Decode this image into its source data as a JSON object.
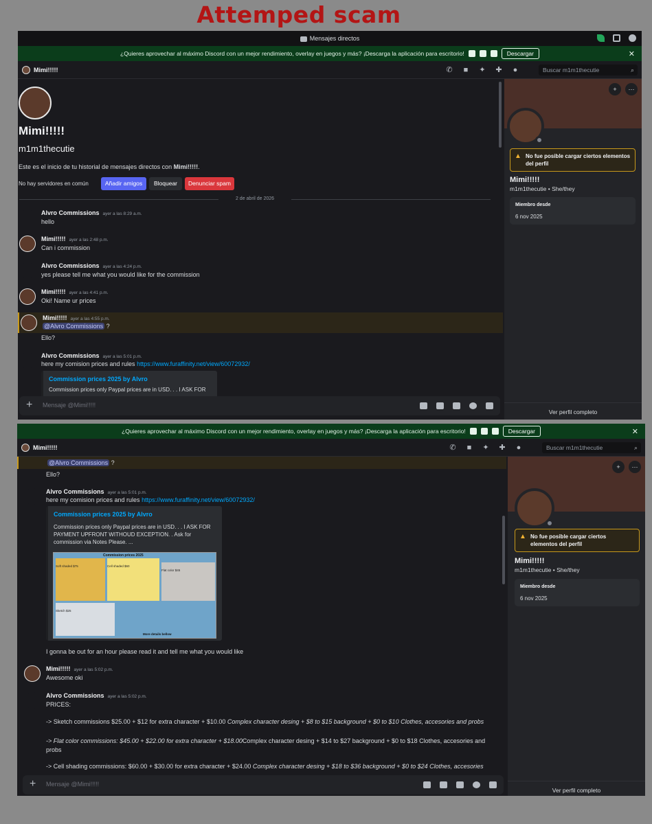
{
  "page_title": "Attemped scam",
  "titlebar": {
    "label": "Mensajes directos"
  },
  "banner": {
    "text": "¿Quieres aprovechar al máximo Discord con un mejor rendimiento, overlay en juegos y más? ¡Descarga la aplicación para escritorio!",
    "download_label": "Descargar",
    "close": "✕"
  },
  "header": {
    "channel_name": "Mimi!!!!!",
    "search_placeholder": "Buscar m1m1thecutie"
  },
  "intro": {
    "display_name": "Mimi!!!!!",
    "username": "m1m1thecutie",
    "start_text_prefix": "Este es el inicio de tu historial de mensajes directos con ",
    "start_text_name": "Mimi!!!!!",
    "start_text_suffix": ".",
    "no_servers": "No hay servidores en común",
    "add_friend": "Añadir amigos",
    "block": "Bloquear",
    "report_spam": "Denunciar spam",
    "date_divider": "2 de abril de 2026"
  },
  "messages": [
    {
      "author": "Alvro Commissions",
      "time": "ayer a las 8:29 a.m.",
      "text": "hello"
    },
    {
      "author": "Mimi!!!!!",
      "time": "ayer a las 2:48 p.m.",
      "text": "Can i commission"
    },
    {
      "author": "Alvro Commissions",
      "time": "ayer a las 4:24 p.m.",
      "text": "yes please tell me what you would like for the commission"
    },
    {
      "author": "Mimi!!!!!",
      "time": "ayer a las 4:41 p.m.",
      "text": "Oki! Name ur prices"
    },
    {
      "author": "Mimi!!!!!",
      "time": "ayer a las 4:55 p.m.",
      "mention": "@Alvro Commissions",
      "mention_suffix": " ?",
      "text": "Ello?"
    },
    {
      "author": "Alvro Commissions",
      "time": "ayer a las 5:01 p.m.",
      "text": "here my comision prices and rules",
      "link": "https://www.furaffinity.net/view/60072932/"
    },
    {
      "after_embed": "I gonna be out for an hour please read it and tell me what you would like"
    },
    {
      "author": "Mimi!!!!!",
      "time": "ayer a las 5:02 p.m.",
      "text": "Awesome oki"
    },
    {
      "author": "Alvro Commissions",
      "time": "ayer a las 5:02 p.m.",
      "text": "PRICES:"
    }
  ],
  "embed": {
    "title": "Commission prices 2025 by Alvro",
    "desc_short": "Commission prices only Paypal prices are in USD. . . I ASK FOR",
    "desc_full": "Commission prices only Paypal prices are in USD. . . I ASK FOR PAYMENT UPFRONT WITHOUD EXCEPTION. . Ask for commission via Notes Please. ...",
    "image_title": "Commission prices 2025",
    "image_labels": [
      "Soft shaded $75",
      "Cell shaded $60",
      "Flat color $45",
      "Sketch $25"
    ],
    "image_note": "More details bellow"
  },
  "prices": {
    "sketch_plain": "-> Sketch commissions $25.00 + $12 for extra character + $10.00 ",
    "sketch_italic": "Complex character desing + $8 to $15 background + $0 to $10 Clothes, accesories and probs",
    "flat_italic": "-> Flat color commissions: $45.00 + $22.00 for extra character + $18.00",
    "flat_plain": "Complex character desing + $14 to $27 background + $0 to $18 Clothes, accesories and probs",
    "cell_plain": "-> Cell shading commissions: $60.00 + $30.00 for extra character + $24.00 ",
    "cell_italic": "Complex character desing + $18 to $36 background + $0 to $24 Clothes, accesories"
  },
  "input": {
    "placeholder": "Mensaje @Mimi!!!!!"
  },
  "profile": {
    "warning": "No fue posible cargar ciertos elementos del perfil",
    "display_name": "Mimi!!!!!",
    "username_line": "m1m1thecutie • She/they",
    "member_since_label": "Miembro desde",
    "member_since_value": "6 nov 2025",
    "full_profile": "Ver perfil completo"
  },
  "colors": {
    "title_red": "#b31515",
    "banner_green": "#0b3d1b",
    "blurple": "#5865f2",
    "danger": "#da373c",
    "link": "#00a8fc"
  }
}
